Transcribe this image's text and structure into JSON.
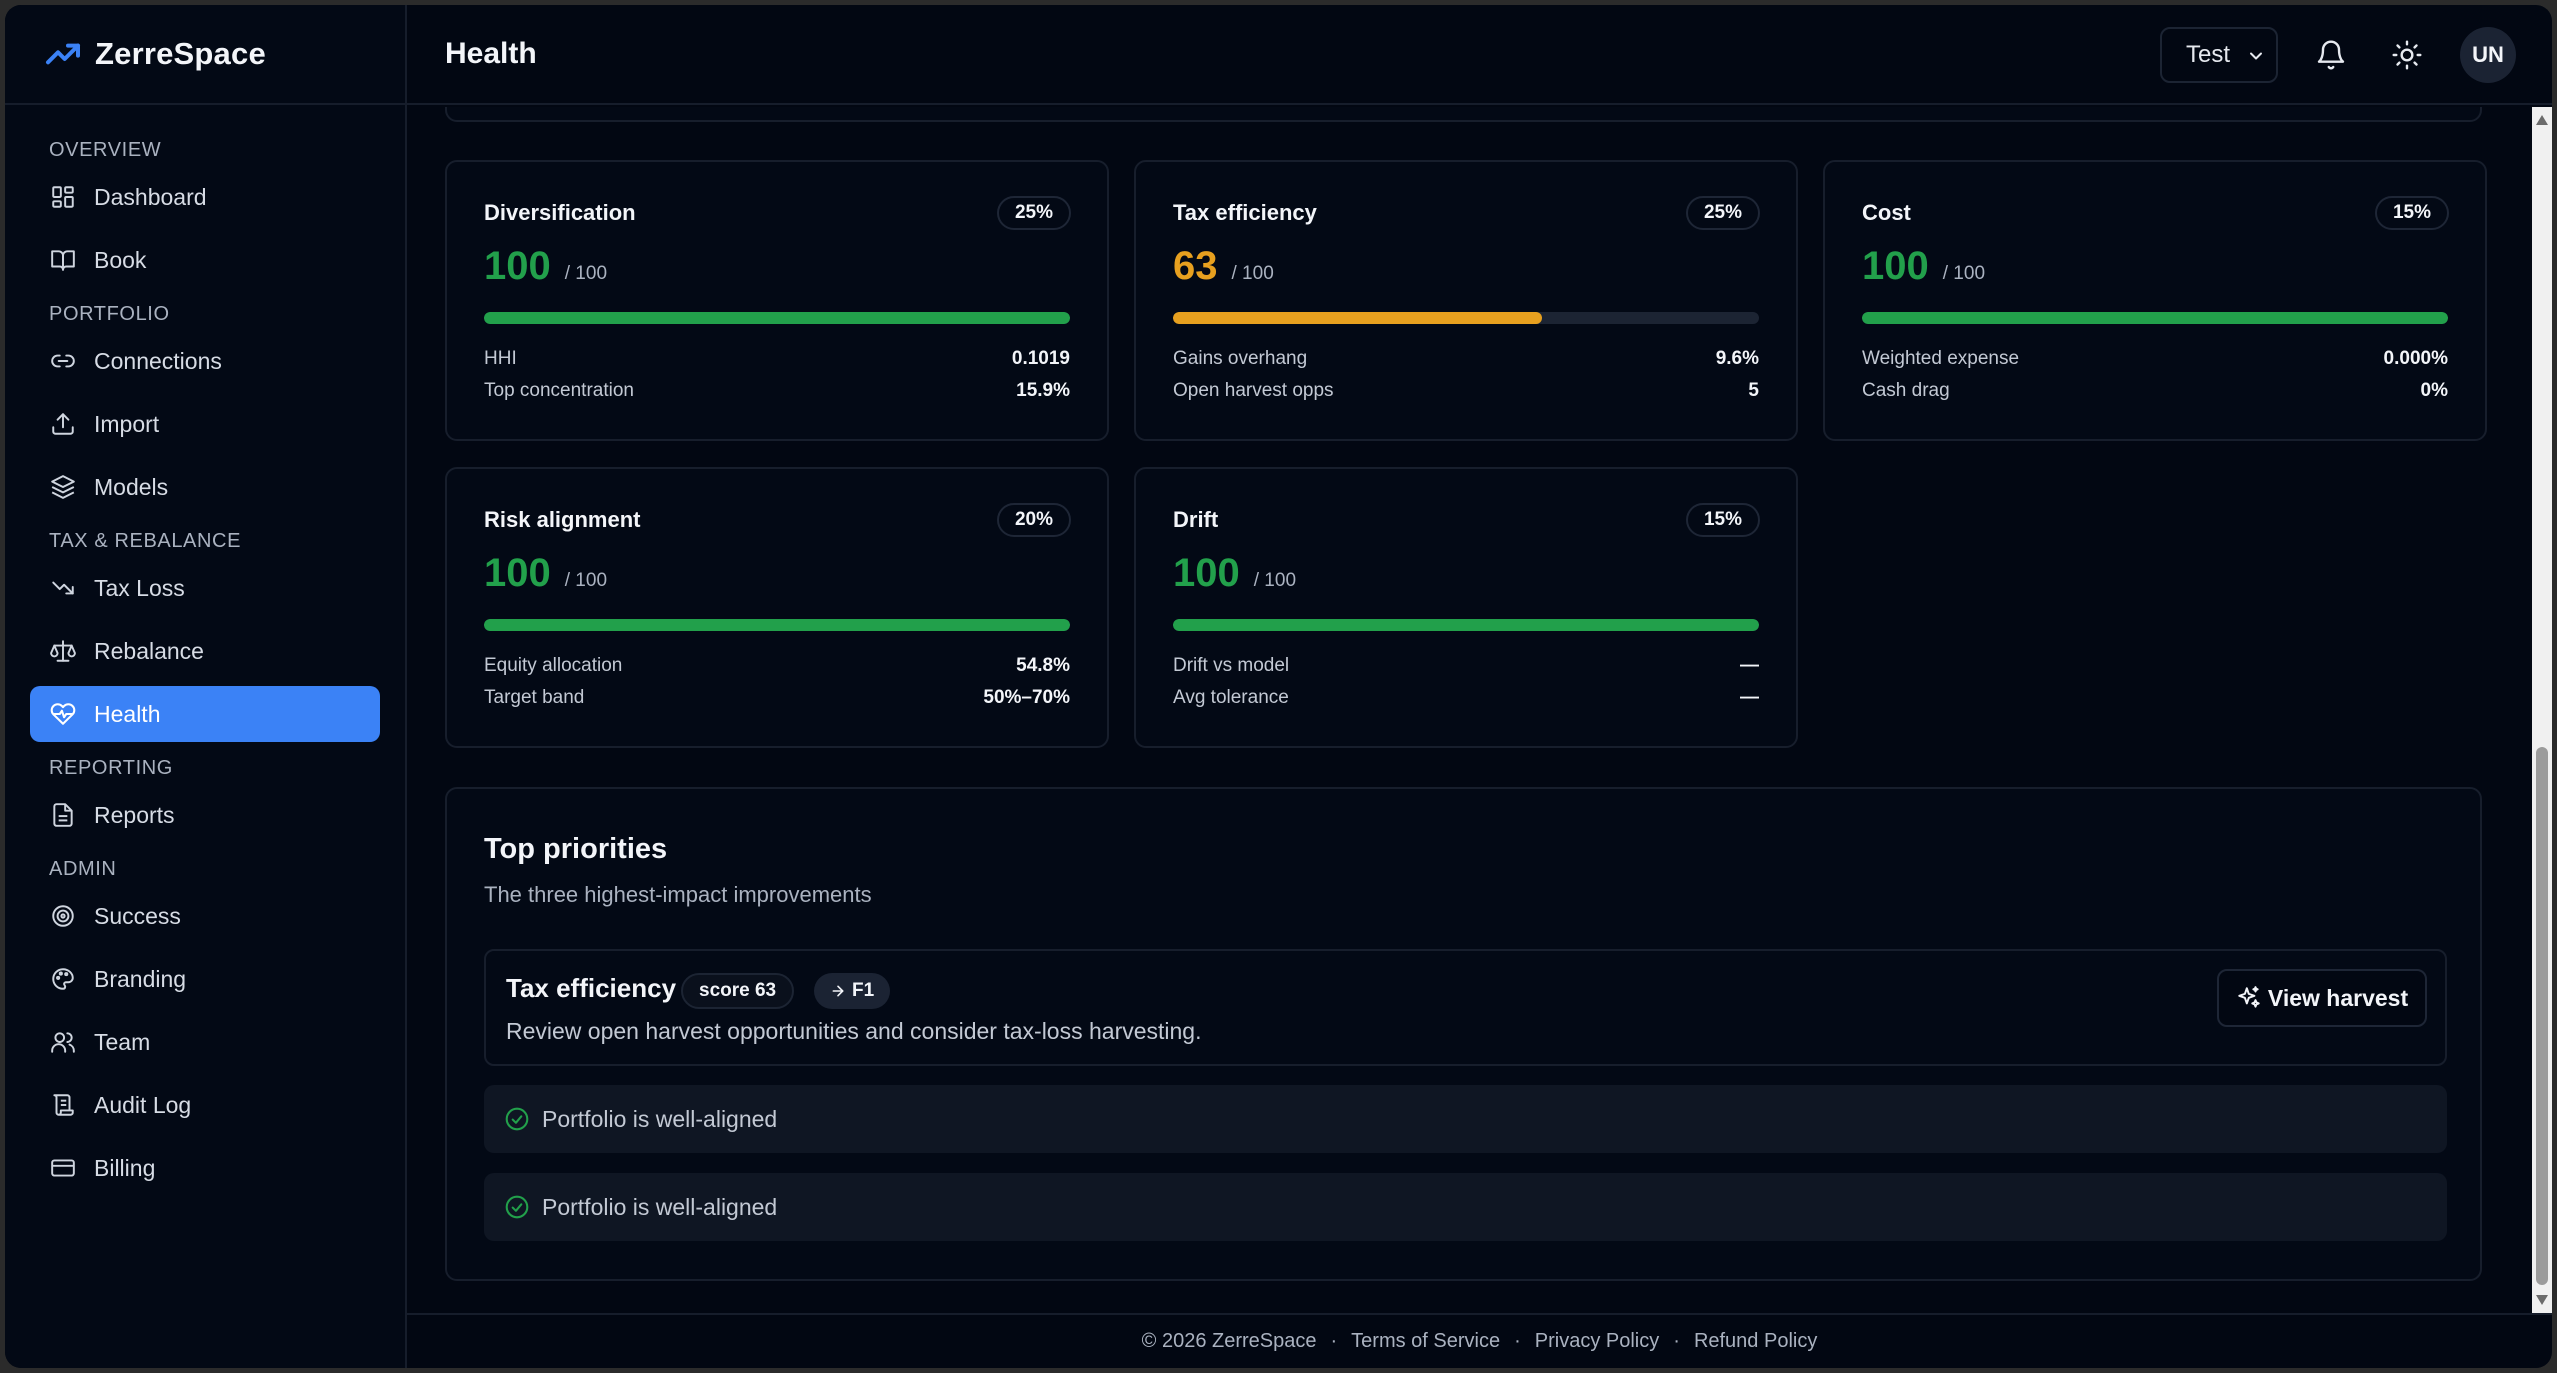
{
  "app": {
    "name": "ZerreSpace"
  },
  "header": {
    "title": "Health",
    "org_select": "Test",
    "avatar_initials": "UN"
  },
  "sidebar": {
    "sections": [
      {
        "title": "OVERVIEW",
        "items": [
          {
            "label": "Dashboard",
            "icon": "dashboard-icon"
          },
          {
            "label": "Book",
            "icon": "book-icon"
          }
        ]
      },
      {
        "title": "PORTFOLIO",
        "items": [
          {
            "label": "Connections",
            "icon": "link-icon"
          },
          {
            "label": "Import",
            "icon": "upload-icon"
          },
          {
            "label": "Models",
            "icon": "layers-icon"
          }
        ]
      },
      {
        "title": "TAX & REBALANCE",
        "items": [
          {
            "label": "Tax Loss",
            "icon": "trending-down-icon"
          },
          {
            "label": "Rebalance",
            "icon": "scale-icon"
          },
          {
            "label": "Health",
            "icon": "heart-pulse-icon",
            "active": true
          }
        ]
      },
      {
        "title": "REPORTING",
        "items": [
          {
            "label": "Reports",
            "icon": "file-text-icon"
          }
        ]
      },
      {
        "title": "ADMIN",
        "items": [
          {
            "label": "Success",
            "icon": "target-icon"
          },
          {
            "label": "Branding",
            "icon": "palette-icon"
          },
          {
            "label": "Team",
            "icon": "users-icon"
          },
          {
            "label": "Audit Log",
            "icon": "scroll-icon"
          },
          {
            "label": "Billing",
            "icon": "credit-card-icon"
          }
        ]
      }
    ]
  },
  "metrics": [
    {
      "title": "Diversification",
      "weight": "25%",
      "score": "100",
      "out_of": "/ 100",
      "fraction": 1.0,
      "status": "good",
      "rows": [
        {
          "label": "HHI",
          "value": "0.1019"
        },
        {
          "label": "Top concentration",
          "value": "15.9%"
        }
      ]
    },
    {
      "title": "Tax efficiency",
      "weight": "25%",
      "score": "63",
      "out_of": "/ 100",
      "fraction": 0.63,
      "status": "warn",
      "rows": [
        {
          "label": "Gains overhang",
          "value": "9.6%"
        },
        {
          "label": "Open harvest opps",
          "value": "5"
        }
      ]
    },
    {
      "title": "Cost",
      "weight": "15%",
      "score": "100",
      "out_of": "/ 100",
      "fraction": 1.0,
      "status": "good",
      "rows": [
        {
          "label": "Weighted expense",
          "value": "0.000%"
        },
        {
          "label": "Cash drag",
          "value": "0%"
        }
      ]
    },
    {
      "title": "Risk alignment",
      "weight": "20%",
      "score": "100",
      "out_of": "/ 100",
      "fraction": 1.0,
      "status": "good",
      "rows": [
        {
          "label": "Equity allocation",
          "value": "54.8%"
        },
        {
          "label": "Target band",
          "value": "50%–70%"
        }
      ]
    },
    {
      "title": "Drift",
      "weight": "15%",
      "score": "100",
      "out_of": "/ 100",
      "fraction": 1.0,
      "status": "good",
      "rows": [
        {
          "label": "Drift vs model",
          "value": "—"
        },
        {
          "label": "Avg tolerance",
          "value": "—"
        }
      ]
    }
  ],
  "priorities": {
    "title": "Top priorities",
    "subtitle": "The three highest-impact improvements",
    "item": {
      "title": "Tax efficiency",
      "score_badge": "score 63",
      "key_badge": "F1",
      "description": "Review open harvest opportunities and consider tax-loss harvesting.",
      "action_label": "View harvest"
    },
    "ok_rows": [
      "Portfolio is well-aligned",
      "Portfolio is well-aligned"
    ]
  },
  "footer": {
    "copyright": "© 2026 ZerreSpace",
    "links": [
      "Terms of Service",
      "Privacy Policy",
      "Refund Policy"
    ],
    "separator": "·"
  },
  "colors": {
    "accent": "#3b82f6",
    "good": "#22a04b",
    "warn": "#e7a01f",
    "background": "#020712"
  }
}
